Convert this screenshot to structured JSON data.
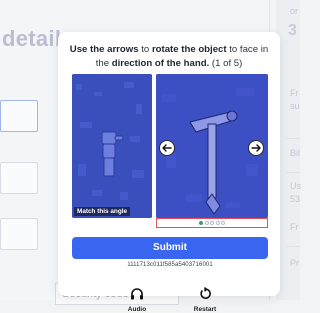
{
  "background": {
    "title": "details",
    "security_field_placeholder": "Security code",
    "right_panel_texts": [
      "or",
      "Fr",
      "su",
      "Bil",
      "Us",
      "53",
      "Fr",
      "Pr"
    ],
    "right_panel_big": "3"
  },
  "captcha": {
    "instruction_parts": {
      "p1": "Use the arrows",
      "p2": " to ",
      "p3": "rotate the object",
      "p4": " to face in the ",
      "p5": "direction of the hand.",
      "p6": " (1 of 5)"
    },
    "match_label": "Match this angle",
    "progress": {
      "current": 1,
      "total": 5
    },
    "submit_label": "Submit",
    "session_id": "1111713c011f585a5403716001",
    "footer": {
      "audio_label": "Audio",
      "restart_label": "Restart"
    }
  },
  "colors": {
    "accent": "#3a65f0",
    "panel_blue": "#3c4fc3",
    "active_dot": "#32a06a",
    "highlight_border": "#e0535a"
  },
  "icons": {
    "left_arrow": "arrow-left-icon",
    "right_arrow": "arrow-right-icon",
    "audio": "headphones-icon",
    "restart": "restart-icon"
  }
}
